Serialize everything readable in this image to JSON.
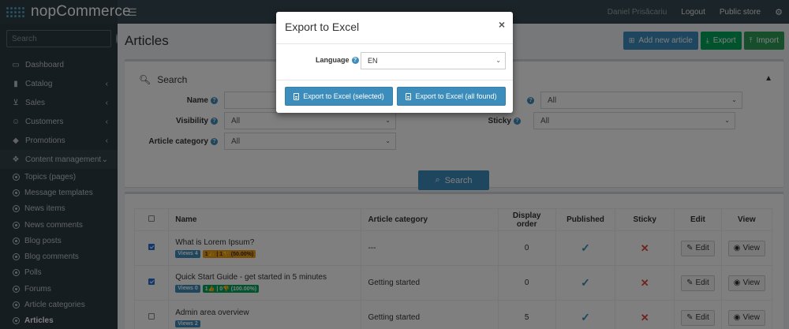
{
  "app": {
    "brand": "nopCommerce"
  },
  "topbar": {
    "user": "Daniel Prisăcariu",
    "logout": "Logout",
    "public_store": "Public store"
  },
  "sidebar": {
    "search_placeholder": "Search",
    "items": [
      {
        "label": "Dashboard",
        "icon": "monitor-icon"
      },
      {
        "label": "Catalog",
        "icon": "book-icon"
      },
      {
        "label": "Sales",
        "icon": "cart-icon"
      },
      {
        "label": "Customers",
        "icon": "user-icon"
      },
      {
        "label": "Promotions",
        "icon": "tags-icon"
      },
      {
        "label": "Content management",
        "icon": "cubes-icon"
      }
    ],
    "sub_items": [
      {
        "label": "Topics (pages)"
      },
      {
        "label": "Message templates"
      },
      {
        "label": "News items"
      },
      {
        "label": "News comments"
      },
      {
        "label": "Blog posts"
      },
      {
        "label": "Blog comments"
      },
      {
        "label": "Polls"
      },
      {
        "label": "Forums"
      },
      {
        "label": "Article categories"
      },
      {
        "label": "Articles"
      }
    ]
  },
  "page": {
    "title": "Articles",
    "buttons": {
      "add_new": "Add new article",
      "export": "Export",
      "import": "Import"
    }
  },
  "search": {
    "heading": "Search",
    "name_label": "Name",
    "visibility_label": "Visibility",
    "visibility_value": "All",
    "category_label": "Article category",
    "category_value": "All",
    "right1_value": "All",
    "sticky_label": "Sticky",
    "sticky_value": "All",
    "button": "Search"
  },
  "grid": {
    "headers": [
      "Name",
      "Article category",
      "Display order",
      "Published",
      "Sticky",
      "Edit",
      "View"
    ],
    "rows": [
      {
        "selected": true,
        "name": "What is Lorem Ipsum?",
        "views": "Views 4",
        "likes": "1👍 | 1👎 (50.00%)",
        "likes_color": "yellow",
        "category": "---",
        "display_order": "0",
        "published": true,
        "sticky": false
      },
      {
        "selected": true,
        "name": "Quick Start Guide - get started in 5 minutes",
        "views": "Views 0",
        "likes": "1👍 | 0👎 (100.00%)",
        "likes_color": "green",
        "category": "Getting started",
        "display_order": "0",
        "published": true,
        "sticky": false
      },
      {
        "selected": false,
        "name": "Admin area overview",
        "views": "Views 2",
        "likes": "",
        "likes_color": "",
        "category": "Getting started",
        "display_order": "5",
        "published": true,
        "sticky": false
      }
    ],
    "edit_label": "Edit",
    "view_label": "View"
  },
  "modal": {
    "title": "Export to Excel",
    "close": "×",
    "language_label": "Language",
    "language_value": "EN",
    "btn_selected": "Export to Excel (selected)",
    "btn_all": "Export to Excel (all found)"
  },
  "colors": {
    "accent": "#3c8dbc",
    "success": "#00a65a",
    "danger": "#dd4b39",
    "sidebar_bg": "#2b3a41"
  }
}
